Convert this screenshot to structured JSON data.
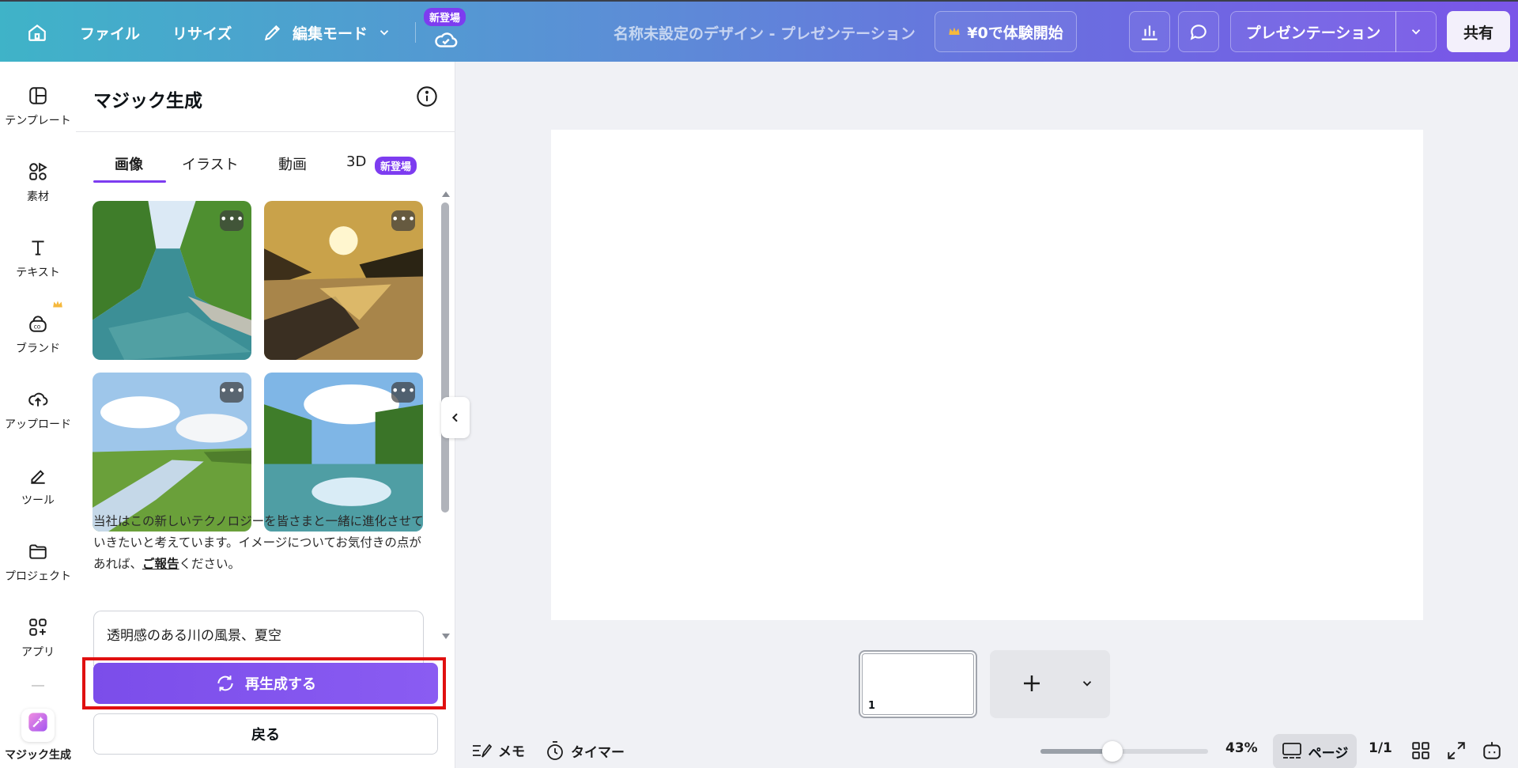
{
  "topbar": {
    "file": "ファイル",
    "resize": "リサイズ",
    "edit_mode": "編集モード",
    "new_badge": "新登場",
    "doc_title": "名称未設定のデザイン - プレゼンテーション",
    "trial": "¥0で体験開始",
    "present": "プレゼンテーション",
    "share": "共有"
  },
  "rail": {
    "items": [
      {
        "label": "テンプレート",
        "icon": "template-icon"
      },
      {
        "label": "素材",
        "icon": "elements-icon"
      },
      {
        "label": "テキスト",
        "icon": "text-icon"
      },
      {
        "label": "ブランド",
        "icon": "brand-icon"
      },
      {
        "label": "アップロード",
        "icon": "upload-icon"
      },
      {
        "label": "ツール",
        "icon": "tools-icon"
      },
      {
        "label": "プロジェクト",
        "icon": "projects-icon"
      },
      {
        "label": "アプリ",
        "icon": "apps-icon"
      },
      {
        "label": "マジック生成",
        "icon": "magic-icon"
      }
    ]
  },
  "panel": {
    "title": "マジック生成",
    "tabs": [
      {
        "label": "画像"
      },
      {
        "label": "イラスト"
      },
      {
        "label": "動画"
      },
      {
        "label": "3D"
      }
    ],
    "tab_badge": "新登場",
    "more": "•••",
    "desc_part1": "当社はこの新しいテクノロジーを皆さまと一緒に進化させていきたいと考えています。イメージについてお気付きの点があれば、",
    "desc_link": "ご報告",
    "desc_part2": "ください。",
    "prompt": "透明感のある川の風景、夏空",
    "regenerate": "再生成する",
    "back": "戻る"
  },
  "canvas": {
    "page_number": "1"
  },
  "bottombar": {
    "notes": "メモ",
    "timer": "タイマー",
    "zoom": "43%",
    "zoom_level": 0.43,
    "page": "ページ",
    "page_count": "1/1"
  },
  "colors": {
    "accent": "#7d3cf0",
    "highlight": "#e01010"
  }
}
